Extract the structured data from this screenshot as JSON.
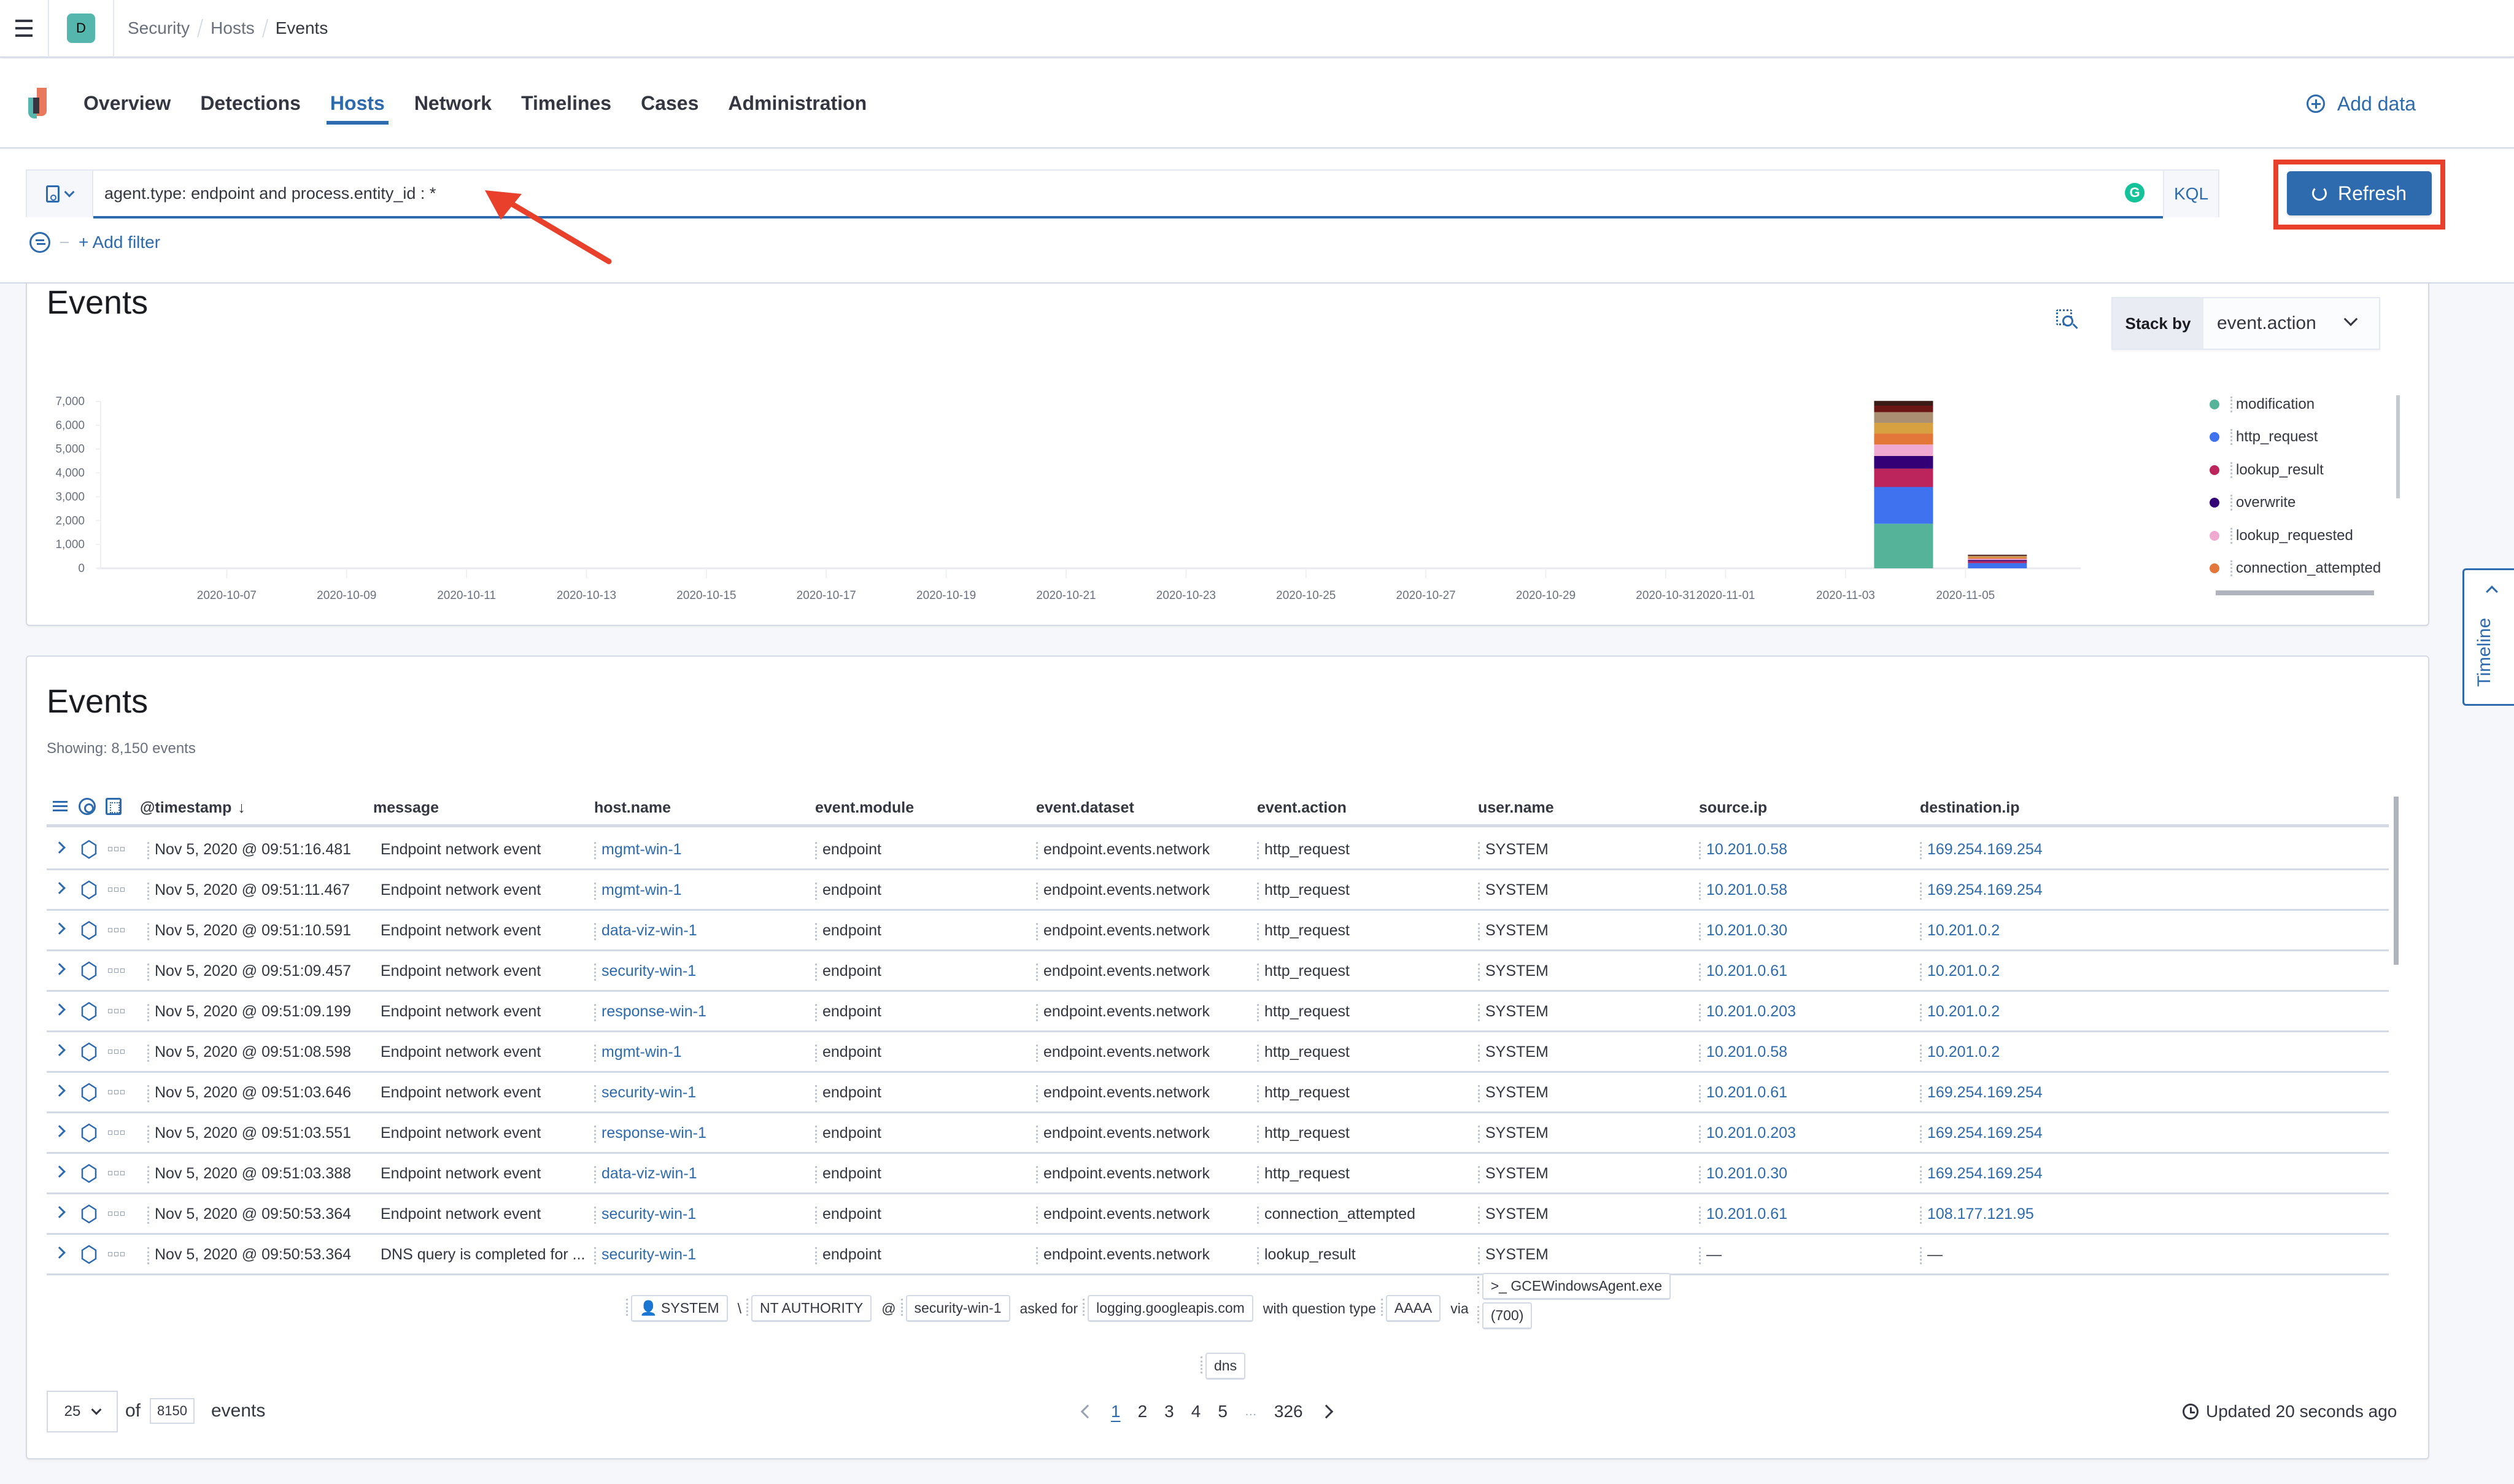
{
  "header": {
    "space_initial": "D",
    "breadcrumbs": [
      "Security",
      "Hosts",
      "Events"
    ]
  },
  "nav": {
    "tabs": [
      "Overview",
      "Detections",
      "Hosts",
      "Network",
      "Timelines",
      "Cases",
      "Administration"
    ],
    "active_tab": "Hosts",
    "add_data_label": "Add data"
  },
  "query": {
    "value": "agent.type: endpoint and process.entity_id : *",
    "language": "KQL",
    "refresh_label": "Refresh",
    "add_filter_label": "+ Add filter"
  },
  "histogram_panel": {
    "title": "Events",
    "stack_by_label": "Stack by",
    "stack_by_value": "event.action"
  },
  "chart_data": {
    "type": "bar",
    "stacked": true,
    "title": "Events",
    "xlabel": "",
    "ylabel": "",
    "ylim": [
      0,
      7000
    ],
    "yticks": [
      0,
      1000,
      2000,
      3000,
      4000,
      5000,
      6000,
      7000
    ],
    "ytick_labels": [
      "0",
      "1,000",
      "2,000",
      "3,000",
      "4,000",
      "5,000",
      "6,000",
      "7,000"
    ],
    "xticks": [
      "2020-10-07",
      "2020-10-09",
      "2020-10-11",
      "2020-10-13",
      "2020-10-15",
      "2020-10-17",
      "2020-10-19",
      "2020-10-21",
      "2020-10-23",
      "2020-10-25",
      "2020-10-27",
      "2020-10-29",
      "2020-10-31",
      "2020-11-01",
      "2020-11-03",
      "2020-11-05"
    ],
    "xrange": [
      "2020-10-05",
      "2020-11-06"
    ],
    "categories": [
      "2020-11-04T12:00",
      "2020-11-05T00:00"
    ],
    "series": [
      {
        "name": "modification",
        "color": "#54b399",
        "values": [
          1870,
          0
        ]
      },
      {
        "name": "http_request",
        "color": "#3f72ee",
        "values": [
          1540,
          220
        ]
      },
      {
        "name": "lookup_result",
        "color": "#bc255c",
        "values": [
          770,
          80
        ]
      },
      {
        "name": "overwrite",
        "color": "#330075",
        "values": [
          530,
          50
        ]
      },
      {
        "name": "lookup_requested",
        "color": "#f0a9d1",
        "values": [
          480,
          50
        ]
      },
      {
        "name": "connection_attempted",
        "color": "#e3773a",
        "values": [
          460,
          50
        ]
      },
      {
        "name": "",
        "color": "#d7a142",
        "values": [
          450,
          40
        ]
      },
      {
        "name": "",
        "color": "#aa8f72",
        "values": [
          450,
          40
        ]
      },
      {
        "name": "",
        "color": "#6b1716",
        "values": [
          270,
          20
        ]
      },
      {
        "name": "",
        "color": "#3a1a14",
        "values": [
          200,
          20
        ]
      }
    ],
    "legend_position": "right",
    "grid": false
  },
  "events_panel": {
    "title": "Events",
    "showing": "Showing: 8,150 events",
    "columns": [
      "@timestamp",
      "message",
      "host.name",
      "event.module",
      "event.dataset",
      "event.action",
      "user.name",
      "source.ip",
      "destination.ip"
    ],
    "sort_indicator": "↓",
    "rows": [
      {
        "timestamp": "Nov 5, 2020 @ 09:51:16.481",
        "message": "Endpoint network event",
        "host": "mgmt-win-1",
        "module": "endpoint",
        "dataset": "endpoint.events.network",
        "action": "http_request",
        "user": "SYSTEM",
        "src": "10.201.0.58",
        "dst": "169.254.169.254"
      },
      {
        "timestamp": "Nov 5, 2020 @ 09:51:11.467",
        "message": "Endpoint network event",
        "host": "mgmt-win-1",
        "module": "endpoint",
        "dataset": "endpoint.events.network",
        "action": "http_request",
        "user": "SYSTEM",
        "src": "10.201.0.58",
        "dst": "169.254.169.254"
      },
      {
        "timestamp": "Nov 5, 2020 @ 09:51:10.591",
        "message": "Endpoint network event",
        "host": "data-viz-win-1",
        "module": "endpoint",
        "dataset": "endpoint.events.network",
        "action": "http_request",
        "user": "SYSTEM",
        "src": "10.201.0.30",
        "dst": "10.201.0.2"
      },
      {
        "timestamp": "Nov 5, 2020 @ 09:51:09.457",
        "message": "Endpoint network event",
        "host": "security-win-1",
        "module": "endpoint",
        "dataset": "endpoint.events.network",
        "action": "http_request",
        "user": "SYSTEM",
        "src": "10.201.0.61",
        "dst": "10.201.0.2"
      },
      {
        "timestamp": "Nov 5, 2020 @ 09:51:09.199",
        "message": "Endpoint network event",
        "host": "response-win-1",
        "module": "endpoint",
        "dataset": "endpoint.events.network",
        "action": "http_request",
        "user": "SYSTEM",
        "src": "10.201.0.203",
        "dst": "10.201.0.2"
      },
      {
        "timestamp": "Nov 5, 2020 @ 09:51:08.598",
        "message": "Endpoint network event",
        "host": "mgmt-win-1",
        "module": "endpoint",
        "dataset": "endpoint.events.network",
        "action": "http_request",
        "user": "SYSTEM",
        "src": "10.201.0.58",
        "dst": "10.201.0.2"
      },
      {
        "timestamp": "Nov 5, 2020 @ 09:51:03.646",
        "message": "Endpoint network event",
        "host": "security-win-1",
        "module": "endpoint",
        "dataset": "endpoint.events.network",
        "action": "http_request",
        "user": "SYSTEM",
        "src": "10.201.0.61",
        "dst": "169.254.169.254"
      },
      {
        "timestamp": "Nov 5, 2020 @ 09:51:03.551",
        "message": "Endpoint network event",
        "host": "response-win-1",
        "module": "endpoint",
        "dataset": "endpoint.events.network",
        "action": "http_request",
        "user": "SYSTEM",
        "src": "10.201.0.203",
        "dst": "169.254.169.254"
      },
      {
        "timestamp": "Nov 5, 2020 @ 09:51:03.388",
        "message": "Endpoint network event",
        "host": "data-viz-win-1",
        "module": "endpoint",
        "dataset": "endpoint.events.network",
        "action": "http_request",
        "user": "SYSTEM",
        "src": "10.201.0.30",
        "dst": "169.254.169.254"
      },
      {
        "timestamp": "Nov 5, 2020 @ 09:50:53.364",
        "message": "Endpoint network event",
        "host": "security-win-1",
        "module": "endpoint",
        "dataset": "endpoint.events.network",
        "action": "connection_attempted",
        "user": "SYSTEM",
        "src": "10.201.0.61",
        "dst": "108.177.121.95"
      },
      {
        "timestamp": "Nov 5, 2020 @ 09:50:53.364",
        "message": "DNS query is completed for ...",
        "host": "security-win-1",
        "module": "endpoint",
        "dataset": "endpoint.events.network",
        "action": "lookup_result",
        "user": "SYSTEM",
        "src": "—",
        "dst": "—"
      }
    ],
    "dns_renderer": {
      "user": "SYSTEM",
      "sep1": "\\",
      "domain": "NT AUTHORITY",
      "at": "@",
      "host": "security-win-1",
      "asked_for": "asked for",
      "question_name": "logging.googleapis.com",
      "with_type": "with question type",
      "question_type": "AAAA",
      "via": "via",
      "process": "GCEWindowsAgent.exe",
      "pid": "(700)",
      "tag": "dns"
    },
    "footer": {
      "page_size": "25",
      "of_label": "of",
      "total": "8150",
      "events_label": "events",
      "pages": [
        "1",
        "2",
        "3",
        "4",
        "5"
      ],
      "ellipsis": "…",
      "last_page": "326",
      "active_page": "1",
      "updated": "Updated 20 seconds ago"
    }
  },
  "timeline_flyout": {
    "label": "Timeline"
  }
}
